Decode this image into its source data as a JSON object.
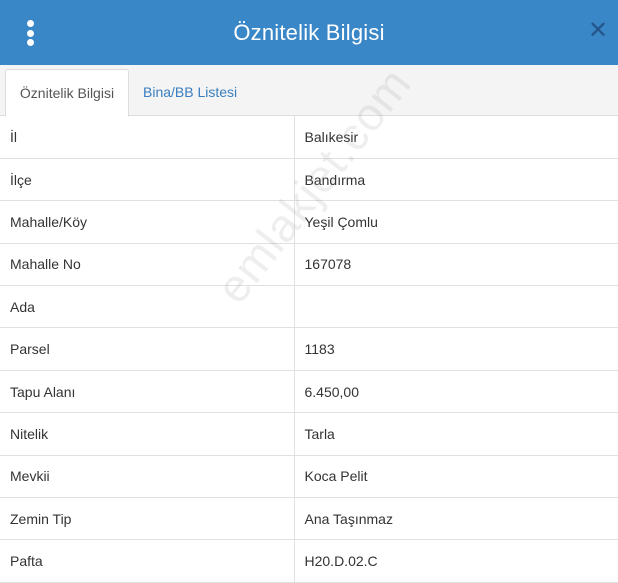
{
  "header": {
    "title": "Öznitelik Bilgisi",
    "menu_icon": "vertical-dots-icon",
    "close_icon": "close-icon",
    "background_color": "#3a87c8"
  },
  "tabs": [
    {
      "label": "Öznitelik Bilgisi",
      "active": true
    },
    {
      "label": "Bina/BB Listesi",
      "active": false
    }
  ],
  "attributes": [
    {
      "key": "İl",
      "value": "Balıkesir"
    },
    {
      "key": "İlçe",
      "value": "Bandırma"
    },
    {
      "key": "Mahalle/Köy",
      "value": "Yeşil Çomlu"
    },
    {
      "key": "Mahalle No",
      "value": "167078"
    },
    {
      "key": "Ada",
      "value": ""
    },
    {
      "key": "Parsel",
      "value": "1183"
    },
    {
      "key": "Tapu Alanı",
      "value": "6.450,00"
    },
    {
      "key": "Nitelik",
      "value": "Tarla"
    },
    {
      "key": "Mevkii",
      "value": "Koca Pelit"
    },
    {
      "key": "Zemin Tip",
      "value": "Ana Taşınmaz"
    },
    {
      "key": "Pafta",
      "value": "H20.D.02.C"
    }
  ],
  "watermark": "emlakjet.com"
}
